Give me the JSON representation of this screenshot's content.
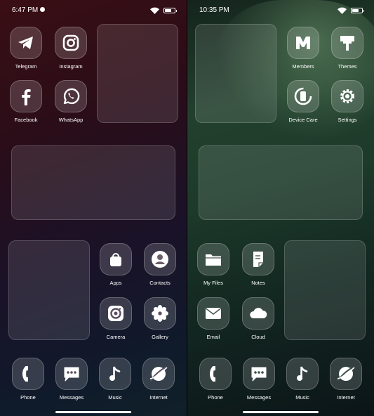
{
  "left": {
    "time": "6:47 PM",
    "apps": [
      {
        "label": "Telegram",
        "icon": "telegram-icon"
      },
      {
        "label": "Instagram",
        "icon": "instagram-icon"
      },
      {
        "label": "Facebook",
        "icon": "facebook-icon"
      },
      {
        "label": "WhatsApp",
        "icon": "whatsapp-icon"
      },
      {
        "label": "Apps",
        "icon": "shopping-bag-icon"
      },
      {
        "label": "Contacts",
        "icon": "contacts-icon"
      },
      {
        "label": "Camera",
        "icon": "camera-icon"
      },
      {
        "label": "Gallery",
        "icon": "flower-icon"
      }
    ],
    "dock": [
      {
        "label": "Phone",
        "icon": "phone-icon"
      },
      {
        "label": "Messages",
        "icon": "messages-icon"
      },
      {
        "label": "Music",
        "icon": "music-note-icon"
      },
      {
        "label": "Internet",
        "icon": "globe-icon"
      }
    ]
  },
  "right": {
    "time": "10:35 PM",
    "apps": [
      {
        "label": "Members",
        "icon": "members-icon"
      },
      {
        "label": "Themes",
        "icon": "paint-brush-icon"
      },
      {
        "label": "Device Care",
        "icon": "device-care-icon"
      },
      {
        "label": "Settings",
        "icon": "gear-icon"
      },
      {
        "label": "My Files",
        "icon": "folder-icon"
      },
      {
        "label": "Notes",
        "icon": "notes-icon"
      },
      {
        "label": "Email",
        "icon": "envelope-icon"
      },
      {
        "label": "Cloud",
        "icon": "cloud-icon"
      }
    ],
    "dock": [
      {
        "label": "Phone",
        "icon": "phone-icon"
      },
      {
        "label": "Messages",
        "icon": "messages-icon"
      },
      {
        "label": "Music",
        "icon": "music-note-icon"
      },
      {
        "label": "Internet",
        "icon": "globe-icon"
      }
    ]
  }
}
